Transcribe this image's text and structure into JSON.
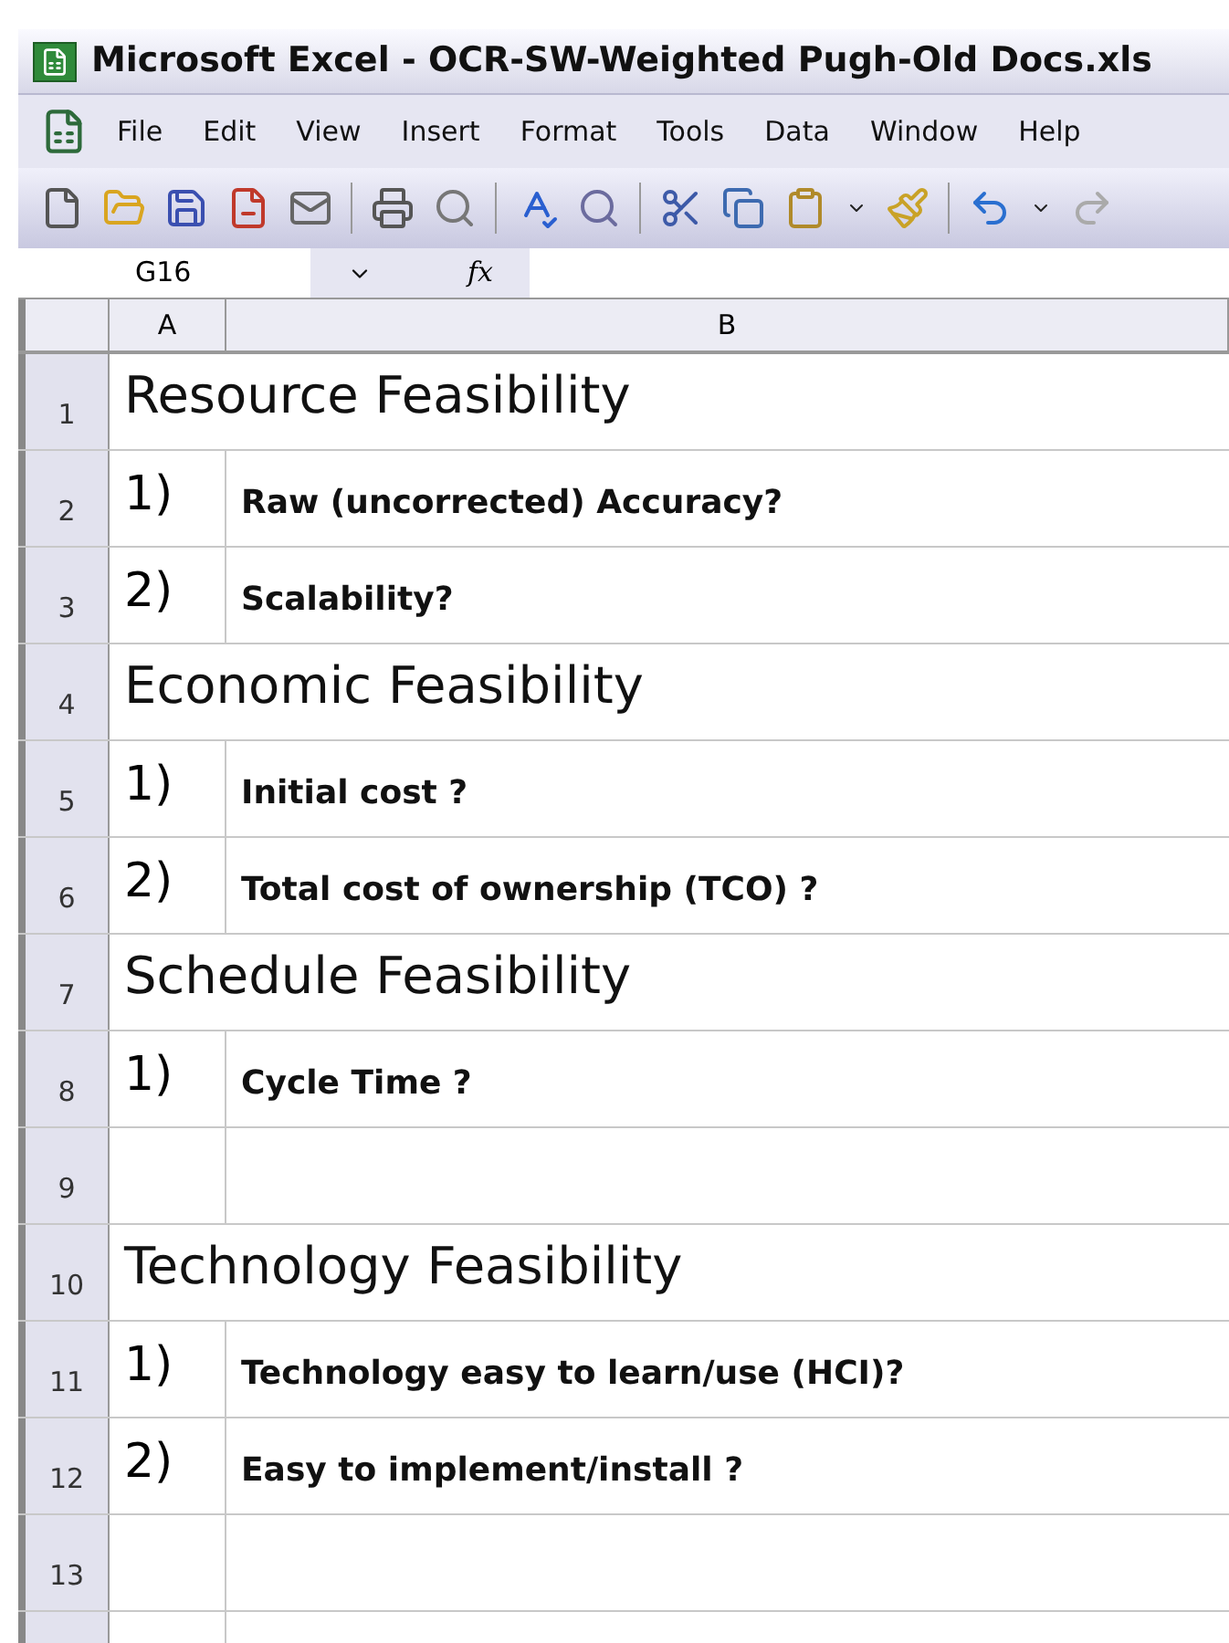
{
  "window": {
    "title": "Microsoft Excel - OCR-SW-Weighted Pugh-Old Docs.xls"
  },
  "menu": [
    "File",
    "Edit",
    "View",
    "Insert",
    "Format",
    "Tools",
    "Data",
    "Window",
    "Help"
  ],
  "formula_bar": {
    "name_box": "G16",
    "fx": "fx"
  },
  "columns": [
    "A",
    "B"
  ],
  "rows": [
    {
      "number": "1",
      "kind": "heading",
      "text": "Resource Feasibility"
    },
    {
      "number": "2",
      "kind": "item",
      "index": "1)",
      "text": "Raw (uncorrected) Accuracy?"
    },
    {
      "number": "3",
      "kind": "item",
      "index": "2)",
      "text": "Scalability?"
    },
    {
      "number": "4",
      "kind": "heading",
      "text": "Economic Feasibility"
    },
    {
      "number": "5",
      "kind": "item",
      "index": "1)",
      "text": "Initial cost ?"
    },
    {
      "number": "6",
      "kind": "item",
      "index": "2)",
      "text": "Total cost of ownership (TCO) ?"
    },
    {
      "number": "7",
      "kind": "heading",
      "text": "Schedule Feasibility"
    },
    {
      "number": "8",
      "kind": "item",
      "index": "1)",
      "text": "Cycle Time ?"
    },
    {
      "number": "9",
      "kind": "empty"
    },
    {
      "number": "10",
      "kind": "heading",
      "text": "Technology Feasibility"
    },
    {
      "number": "11",
      "kind": "item",
      "index": "1)",
      "text": "Technology easy to learn/use (HCI)?"
    },
    {
      "number": "12",
      "kind": "item",
      "index": "2)",
      "text": "Easy to implement/install ?"
    },
    {
      "number": "13",
      "kind": "empty"
    }
  ]
}
